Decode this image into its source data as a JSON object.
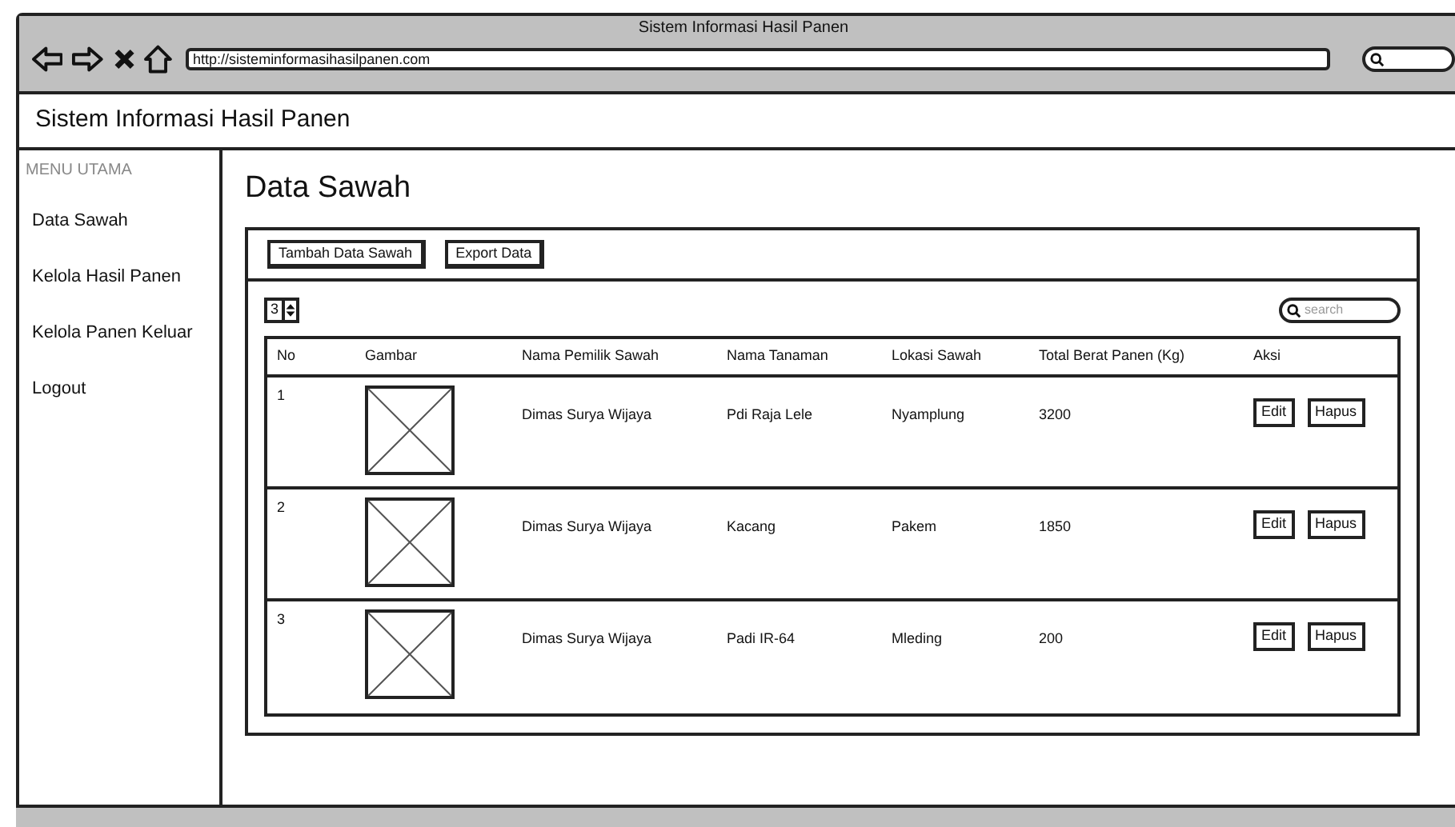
{
  "window": {
    "title": "Sistem Informasi Hasil Panen",
    "url": "http://sisteminformasihasilpanen.com"
  },
  "app_header": {
    "title": "Sistem Informasi Hasil Panen"
  },
  "sidebar": {
    "heading": "MENU UTAMA",
    "items": [
      {
        "label": "Data Sawah"
      },
      {
        "label": "Kelola Hasil Panen"
      },
      {
        "label": "Kelola Panen Keluar"
      },
      {
        "label": "Logout"
      }
    ]
  },
  "page_title": "Data Sawah",
  "toolbar": {
    "buttons": [
      "Tambah Data Sawah",
      "Export Data"
    ]
  },
  "page_size": "3",
  "search": {
    "placeholder": "search"
  },
  "table": {
    "columns": [
      "No",
      "Gambar",
      "Nama Pemilik Sawah",
      "Nama Tanaman",
      "Lokasi Sawah",
      "Total Berat Panen (Kg)",
      "Aksi"
    ],
    "rows": [
      {
        "no": "1",
        "owner": "Dimas Surya Wijaya",
        "plant": "Pdi Raja Lele",
        "location": "Nyamplung",
        "weight": "3200",
        "actions": [
          "Edit",
          "Hapus"
        ]
      },
      {
        "no": "2",
        "owner": "Dimas Surya Wijaya",
        "plant": "Kacang",
        "location": "Pakem",
        "weight": "1850",
        "actions": [
          "Edit",
          "Hapus"
        ]
      },
      {
        "no": "3",
        "owner": "Dimas Surya Wijaya",
        "plant": "Padi IR-64",
        "location": "Mleding",
        "weight": "200",
        "actions": [
          "Edit",
          "Hapus"
        ]
      }
    ]
  }
}
